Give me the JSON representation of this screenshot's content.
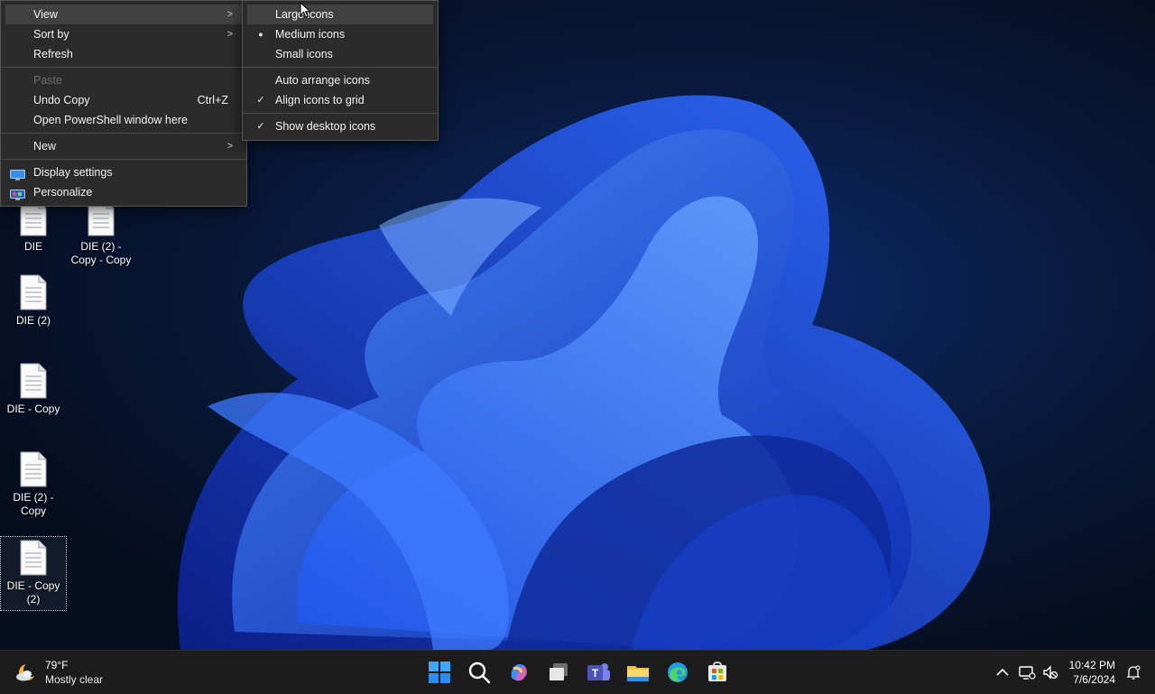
{
  "context_menu": {
    "items": [
      {
        "label": "View"
      },
      {
        "label": "Sort by"
      },
      {
        "label": "Refresh"
      },
      {
        "label": "Paste"
      },
      {
        "label": "Undo Copy",
        "shortcut": "Ctrl+Z"
      },
      {
        "label": "Open PowerShell window here"
      },
      {
        "label": "New"
      },
      {
        "label": "Display settings"
      },
      {
        "label": "Personalize"
      }
    ]
  },
  "view_submenu": {
    "items": [
      {
        "label": "Large icons"
      },
      {
        "label": "Medium icons",
        "mark": "●"
      },
      {
        "label": "Small icons"
      },
      {
        "label": "Auto arrange icons"
      },
      {
        "label": "Align icons to grid",
        "mark": "✓"
      },
      {
        "label": "Show desktop icons",
        "mark": "✓"
      }
    ]
  },
  "desktop_icons": [
    {
      "label": "DIE"
    },
    {
      "label": "DIE (2) - Copy - Copy"
    },
    {
      "label": "DIE (2)"
    },
    {
      "label": "DIE - Copy"
    },
    {
      "label": "DIE (2) - Copy"
    },
    {
      "label": "DIE - Copy (2)"
    }
  ],
  "taskbar": {
    "weather": {
      "temp": "79°F",
      "condition": "Mostly clear"
    },
    "apps": [
      "start-icon",
      "search-icon",
      "copilot-icon",
      "task-view-icon",
      "teams-icon",
      "file-explorer-icon",
      "edge-icon",
      "store-icon"
    ],
    "tray_arrow": "^",
    "clock": {
      "time": "10:42 PM",
      "date": "7/6/2024"
    }
  },
  "colors": {
    "menu_bg": "#2b2b2b",
    "menu_hover": "#414141",
    "taskbar_bg": "#1c1c1c",
    "accent": "#1a73ff"
  }
}
